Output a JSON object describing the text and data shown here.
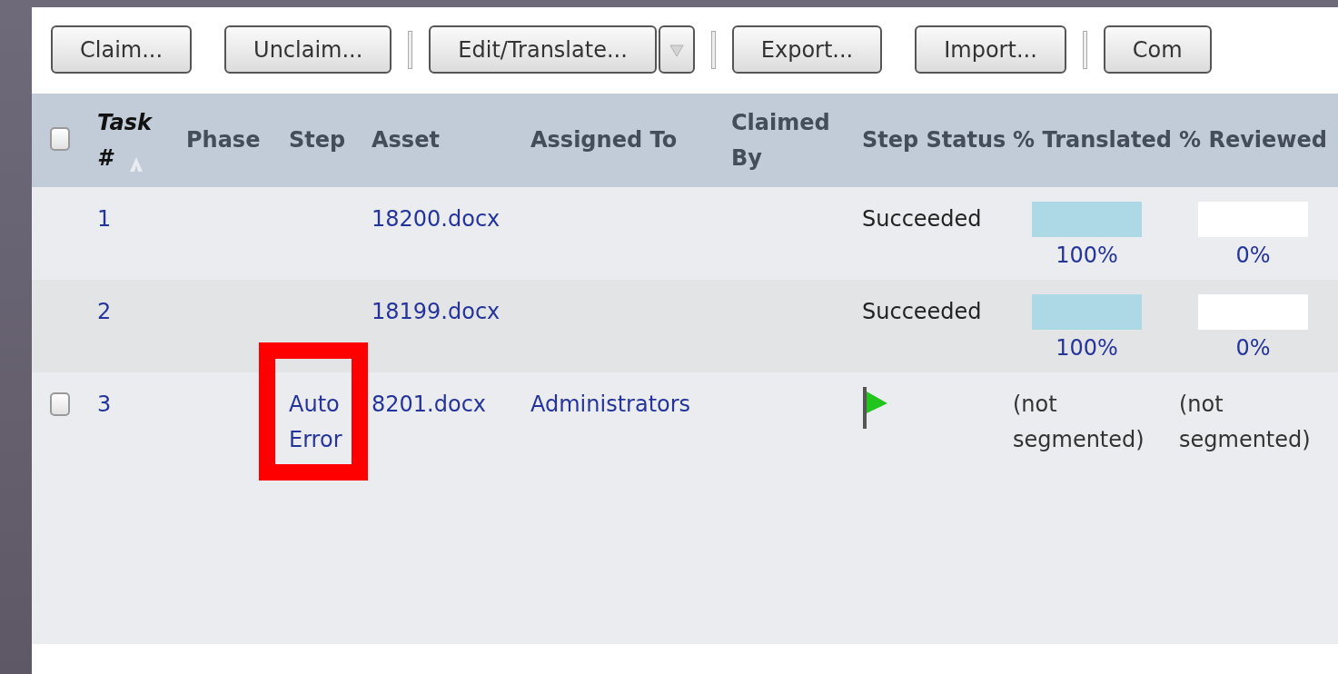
{
  "toolbar": [
    {
      "kind": "button",
      "label": "Claim..."
    },
    {
      "kind": "button",
      "label": "Unclaim..."
    },
    {
      "kind": "separator"
    },
    {
      "kind": "split",
      "label": "Edit/Translate..."
    },
    {
      "kind": "separator"
    },
    {
      "kind": "button",
      "label": "Export..."
    },
    {
      "kind": "button",
      "label": "Import..."
    },
    {
      "kind": "separator"
    },
    {
      "kind": "button",
      "label": "Com"
    }
  ],
  "table": {
    "select_all": {
      "checked": false
    },
    "columns": [
      {
        "label": "Task #",
        "sorted": true
      },
      {
        "label": "Phase",
        "sorted": false
      },
      {
        "label": "Step",
        "sorted": false
      },
      {
        "label": "Asset",
        "sorted": false
      },
      {
        "label": "Assigned To",
        "sorted": false
      },
      {
        "label": "Claimed By",
        "sorted": false
      },
      {
        "label": "Step Status",
        "sorted": false
      },
      {
        "label": "% Translated",
        "sorted": false
      },
      {
        "label": "% Reviewed",
        "sorted": false
      }
    ],
    "rows": [
      {
        "task": "1",
        "step": "",
        "step_highlighted": false,
        "asset": "18200.docx",
        "assigned_to": "",
        "status": {
          "kind": "text",
          "text": "Succeeded"
        },
        "translated": {
          "kind": "bar",
          "level": 1,
          "reading": "100%"
        },
        "reviewed": {
          "kind": "bar",
          "level": 0,
          "reading": "0%"
        }
      },
      {
        "task": "2",
        "step": "",
        "step_highlighted": false,
        "asset": "18199.docx",
        "assigned_to": "",
        "status": {
          "kind": "text",
          "text": "Succeeded"
        },
        "translated": {
          "kind": "bar",
          "level": 1,
          "reading": "100%"
        },
        "reviewed": {
          "kind": "bar",
          "level": 0,
          "reading": "0%"
        }
      },
      {
        "checked": false,
        "task": "3",
        "step": "Auto Error",
        "step_highlighted": true,
        "asset": "8201.docx",
        "assigned_to": "Administrators",
        "status": {
          "kind": "flag"
        },
        "translated": {
          "kind": "text",
          "text": "(not segmented)"
        },
        "reviewed": {
          "kind": "text",
          "text": "(not segmented)"
        }
      }
    ]
  }
}
